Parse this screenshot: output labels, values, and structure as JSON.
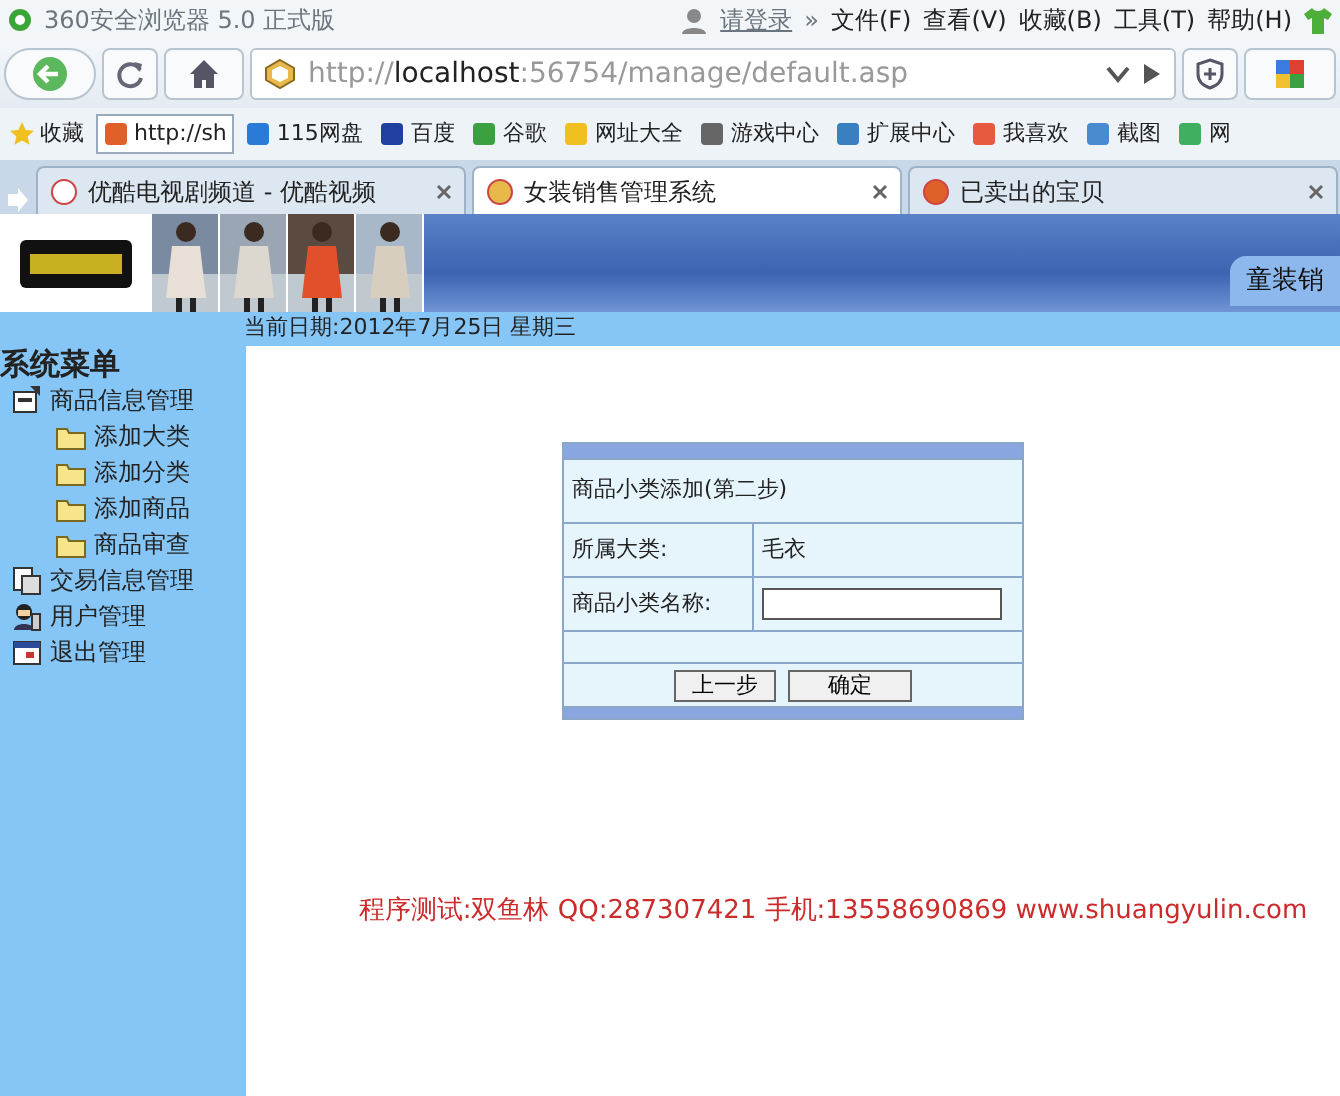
{
  "browser": {
    "title": "360安全浏览器 5.0 正式版",
    "login": "请登录",
    "more": "»",
    "menus": [
      "文件(F)",
      "查看(V)",
      "收藏(B)",
      "工具(T)",
      "帮助(H)"
    ],
    "address": {
      "scheme": "http://",
      "host": "localhost",
      "rest": ":56754/manage/default.asp"
    }
  },
  "bookmarks": [
    {
      "label": "收藏"
    },
    {
      "label": "http://sh"
    },
    {
      "label": "115网盘"
    },
    {
      "label": "百度"
    },
    {
      "label": "谷歌"
    },
    {
      "label": "网址大全"
    },
    {
      "label": "游戏中心"
    },
    {
      "label": "扩展中心"
    },
    {
      "label": "我喜欢"
    },
    {
      "label": "截图"
    },
    {
      "label": "网"
    }
  ],
  "tabs": [
    {
      "label": "优酷电视剧频道 - 优酷视频",
      "selected": false
    },
    {
      "label": "女装销售管理系统",
      "selected": true
    },
    {
      "label": "已卖出的宝贝",
      "selected": false
    }
  ],
  "page": {
    "banner_tab": "童装销",
    "date": "当前日期:2012年7月25日 星期三",
    "menu_title": "系统菜单",
    "menu": [
      {
        "label": "商品信息管理",
        "children": [
          {
            "label": "添加大类"
          },
          {
            "label": "添加分类"
          },
          {
            "label": "添加商品"
          },
          {
            "label": "商品审查"
          }
        ]
      },
      {
        "label": "交易信息管理"
      },
      {
        "label": "用户管理"
      },
      {
        "label": "退出管理"
      }
    ],
    "form": {
      "title": "商品小类添加(第二步)",
      "rows": [
        {
          "kind": "text",
          "label": "所属大类:",
          "value": "毛衣"
        },
        {
          "kind": "input",
          "label": "商品小类名称:"
        }
      ],
      "buttons": [
        "上一步",
        "确定"
      ]
    },
    "footer": "程序测试:双鱼林 QQ:287307421 手机:13558690869 www.shuangyulin.com"
  }
}
